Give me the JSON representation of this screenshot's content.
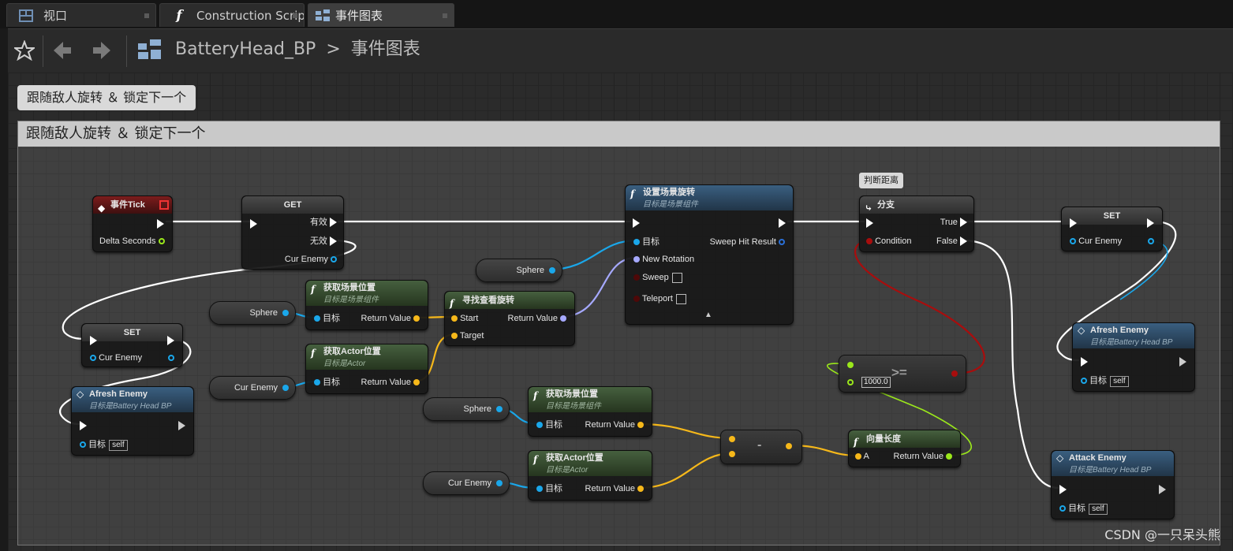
{
  "tabs": [
    {
      "label": "视口",
      "icon": "viewport-icon"
    },
    {
      "label": "Construction Scrip",
      "icon": "function-icon"
    },
    {
      "label": "事件图表",
      "icon": "event-graph-icon"
    }
  ],
  "toolbar": {
    "blueprint_name": "BatteryHead_BP",
    "separator": ">",
    "graph_name": "事件图表"
  },
  "comment": {
    "bubble": "跟随敌人旋转 ＆ 锁定下一个",
    "header": "跟随敌人旋转 ＆ 锁定下一个"
  },
  "nodes": {
    "event_tick": {
      "title": "事件Tick",
      "delta": "Delta Seconds"
    },
    "get": {
      "title": "GET",
      "valid": "有效",
      "invalid": "无效",
      "cur_enemy": "Cur Enemy"
    },
    "set_left": {
      "title": "SET",
      "cur_enemy": "Cur Enemy"
    },
    "afresh_left": {
      "title": "Afresh Enemy",
      "subtitle": "目标是Battery Head BP",
      "target": "目标",
      "self": "self"
    },
    "sphere1": {
      "label": "Sphere"
    },
    "curenemy1": {
      "label": "Cur Enemy"
    },
    "get_loc1": {
      "title": "获取场景位置",
      "subtitle": "目标是场景组件",
      "target": "目标",
      "return": "Return Value"
    },
    "get_actor_loc1": {
      "title": "获取Actor位置",
      "subtitle": "目标是Actor",
      "target": "目标",
      "return": "Return Value"
    },
    "find_look": {
      "title": "寻找查看旋转",
      "start": "Start",
      "target": "Target",
      "return": "Return Value"
    },
    "sphere2": {
      "label": "Sphere"
    },
    "set_rot": {
      "title": "设置场景旋转",
      "subtitle": "目标是场景组件",
      "target": "目标",
      "new_rotation": "New Rotation",
      "sweep": "Sweep",
      "teleport": "Teleport",
      "sweep_hit": "Sweep Hit Result"
    },
    "sphere3": {
      "label": "Sphere"
    },
    "curenemy2": {
      "label": "Cur Enemy"
    },
    "get_loc2": {
      "title": "获取场景位置",
      "subtitle": "目标是场景组件",
      "target": "目标",
      "return": "Return Value"
    },
    "get_actor_loc2": {
      "title": "获取Actor位置",
      "subtitle": "目标是Actor",
      "target": "目标",
      "return": "Return Value"
    },
    "minus": {
      "op": "-"
    },
    "vec_len": {
      "title": "向量长度",
      "a": "A",
      "return": "Return Value"
    },
    "compare": {
      "op": ">=",
      "value": "1000.0"
    },
    "branch": {
      "title": "分支",
      "condition": "Condition",
      "true": "True",
      "false": "False",
      "bubble": "判断距离"
    },
    "set_right": {
      "title": "SET",
      "cur_enemy": "Cur Enemy"
    },
    "afresh_right": {
      "title": "Afresh Enemy",
      "subtitle": "目标是Battery Head BP",
      "target": "目标",
      "self": "self"
    },
    "attack": {
      "title": "Attack Enemy",
      "subtitle": "目标是Battery Head BP",
      "target": "目标",
      "self": "self"
    }
  },
  "colors": {
    "exec_wire": "#ffffff",
    "object_wire": "#1aa7ea",
    "vector_wire": "#f6b81a",
    "rotator_wire": "#a6a9ff",
    "bool_wire": "#a80d0d",
    "float_wire": "#9be81b"
  },
  "watermark": "CSDN @一只呆头熊"
}
